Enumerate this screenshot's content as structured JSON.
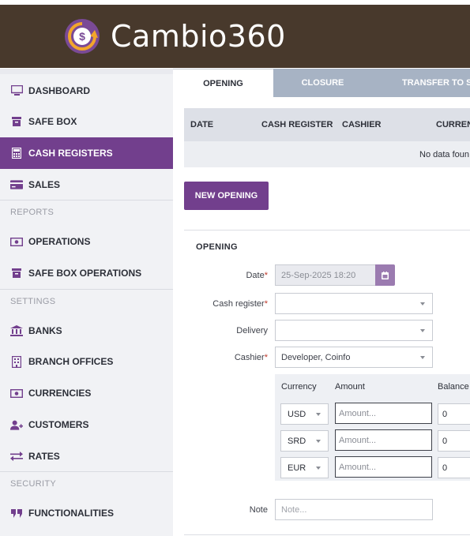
{
  "app": {
    "name": "Cambio360"
  },
  "sidebar": {
    "items": [
      {
        "label": "DASHBOARD",
        "icon": "monitor-icon"
      },
      {
        "label": "SAFE BOX",
        "icon": "safe-box-icon"
      },
      {
        "label": "CASH REGISTERS",
        "icon": "calculator-icon",
        "active": true
      },
      {
        "label": "SALES",
        "icon": "card-icon"
      }
    ],
    "reports_label": "REPORTS",
    "reports": [
      {
        "label": "OPERATIONS",
        "icon": "money-icon"
      },
      {
        "label": "SAFE BOX OPERATIONS",
        "icon": "safe-box-icon"
      }
    ],
    "settings_label": "SETTINGS",
    "settings": [
      {
        "label": "BANKS",
        "icon": "bank-icon"
      },
      {
        "label": "BRANCH OFFICES",
        "icon": "building-icon"
      },
      {
        "label": "CURRENCIES",
        "icon": "money-icon"
      },
      {
        "label": "CUSTOMERS",
        "icon": "add-user-icon"
      },
      {
        "label": "RATES",
        "icon": "exchange-icon"
      }
    ],
    "security_label": "SECURITY",
    "security": [
      {
        "label": "FUNCTIONALITIES",
        "icon": "quote-icon"
      }
    ]
  },
  "tabs": [
    {
      "label": "OPENING",
      "active": true
    },
    {
      "label": "CLOSURE"
    },
    {
      "label": "TRANSFER TO S"
    }
  ],
  "grid": {
    "columns": [
      "DATE",
      "CASH REGISTER",
      "CASHIER",
      "CURREN"
    ],
    "empty_text": "No data foun"
  },
  "new_opening_label": "NEW OPENING",
  "form": {
    "title": "OPENING",
    "date_label": "Date",
    "date_value": "25-Sep-2025 18:20",
    "cash_register_label": "Cash register",
    "cash_register_value": "",
    "delivery_label": "Delivery",
    "delivery_value": "",
    "cashier_label": "Cashier",
    "cashier_value": "Developer, Coinfo",
    "required_mark": "*",
    "currency_table": {
      "headers": [
        "Currency",
        "Amount",
        "Balance"
      ],
      "rows": [
        {
          "currency": "USD",
          "amount_placeholder": "Amount...",
          "balance": "0"
        },
        {
          "currency": "SRD",
          "amount_placeholder": "Amount...",
          "balance": "0"
        },
        {
          "currency": "EUR",
          "amount_placeholder": "Amount...",
          "balance": "0"
        }
      ]
    },
    "note_label": "Note",
    "note_placeholder": "Note..."
  },
  "colors": {
    "brand_purple": "#723f8d",
    "header_brown": "#48392c",
    "tab_inactive": "#a7b3c4"
  }
}
